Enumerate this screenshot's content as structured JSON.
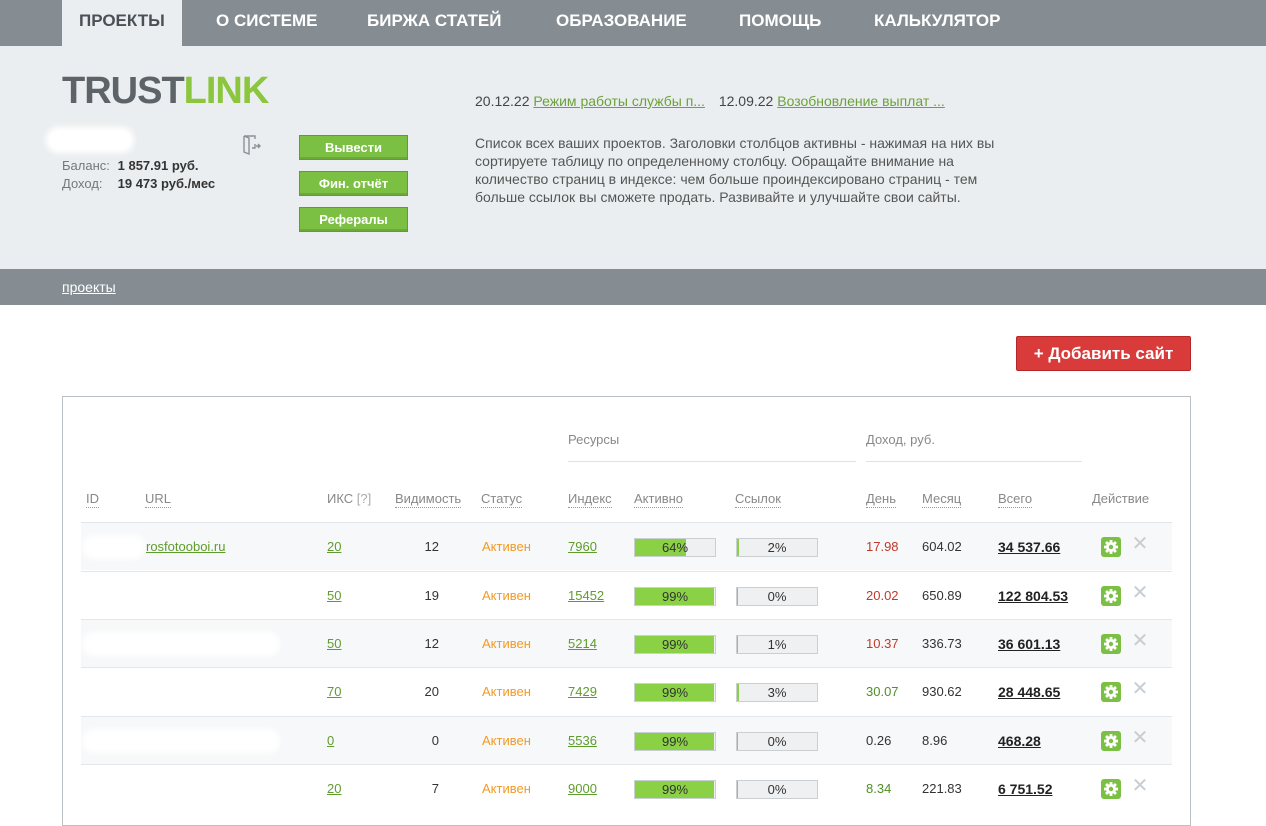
{
  "nav": {
    "tabs": [
      {
        "label": "ПРОЕКТЫ"
      },
      {
        "label": "О СИСТЕМЕ"
      },
      {
        "label": "БИРЖА СТАТЕЙ"
      },
      {
        "label": "ОБРАЗОВАНИЕ"
      },
      {
        "label": "ПОМОЩЬ"
      },
      {
        "label": "КАЛЬКУЛЯТОР"
      }
    ]
  },
  "logo": {
    "part1": "TRUST",
    "part2": "LINK"
  },
  "account": {
    "balance_label": "Баланс:",
    "balance_value": "1 857.91 руб.",
    "income_label": "Доход:",
    "income_value": "19 473 руб./мес"
  },
  "buttons": {
    "withdraw": "Вывести",
    "fin_report": "Фин. отчёт",
    "referrals": "Рефералы",
    "add_site": "+ Добавить сайт"
  },
  "news": [
    {
      "date": "20.12.22",
      "title": "Режим работы службы п..."
    },
    {
      "date": "12.09.22",
      "title": "Возобновление выплат ..."
    }
  ],
  "intro_text": "Список всех ваших проектов. Заголовки столбцов активны - нажимая на них вы сортируете таблицу по определенному столбцу. Обращайте внимание на количество страниц в индексе: чем больше проиндексировано страниц - тем больше ссылок вы сможете продать. Развивайте и улучшайте свои сайты.",
  "breadcrumb": {
    "projects": "проекты"
  },
  "table": {
    "group_headers": {
      "resources": "Ресурсы",
      "income": "Доход,  руб."
    },
    "columns": {
      "id": "ID",
      "url": "URL",
      "iks": "ИКС",
      "iks_hint": "[?]",
      "visibility": "Видимость",
      "status": "Статус",
      "index": "Индекс",
      "active": "Активно",
      "links": "Ссылок",
      "day": "День",
      "month": "Месяц",
      "total": "Всего",
      "action": "Действие"
    },
    "rows": [
      {
        "url": "rosfotooboi.ru",
        "iks": "20",
        "visibility": "12",
        "status": "Активен",
        "index": "7960",
        "active_pct": 64,
        "active_label": "64%",
        "links_pct": 2,
        "links_label": "2%",
        "day": "17.98",
        "day_color": "red",
        "month": "604.02",
        "total": "34 537.66"
      },
      {
        "url": "",
        "iks": "50",
        "visibility": "19",
        "status": "Активен",
        "index": "15452",
        "active_pct": 99,
        "active_label": "99%",
        "links_pct": 0,
        "links_label": "0%",
        "day": "20.02",
        "day_color": "red",
        "month": "650.89",
        "total": "122 804.53"
      },
      {
        "url": "",
        "iks": "50",
        "visibility": "12",
        "status": "Активен",
        "index": "5214",
        "active_pct": 99,
        "active_label": "99%",
        "links_pct": 1,
        "links_label": "1%",
        "day": "10.37",
        "day_color": "red",
        "month": "336.73",
        "total": "36 601.13"
      },
      {
        "url": "",
        "iks": "70",
        "visibility": "20",
        "status": "Активен",
        "index": "7429",
        "active_pct": 99,
        "active_label": "99%",
        "links_pct": 3,
        "links_label": "3%",
        "day": "30.07",
        "day_color": "green",
        "month": "930.62",
        "total": "28 448.65"
      },
      {
        "url": "",
        "iks": "0",
        "visibility": "0",
        "status": "Активен",
        "index": "5536",
        "active_pct": 99,
        "active_label": "99%",
        "links_pct": 0,
        "links_label": "0%",
        "day": "0.26",
        "day_color": "dark",
        "month": "8.96",
        "total": "468.28"
      },
      {
        "url": "",
        "iks": "20",
        "visibility": "7",
        "status": "Активен",
        "index": "9000",
        "active_pct": 99,
        "active_label": "99%",
        "links_pct": 0,
        "links_label": "0%",
        "day": "8.34",
        "day_color": "green",
        "month": "221.83",
        "total": "6 751.52"
      }
    ]
  },
  "colors": {
    "nav_bg": "#858d92",
    "header_bg": "#ebeef0",
    "accent_green": "#7bc043",
    "add_red": "#d93a3a",
    "status_orange": "#f39a22"
  }
}
